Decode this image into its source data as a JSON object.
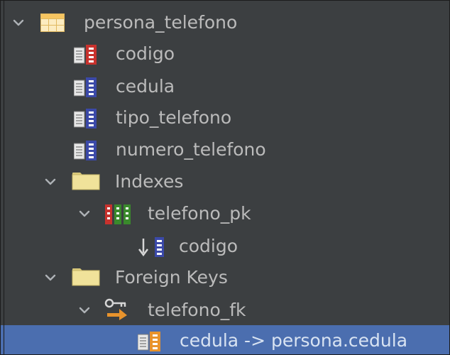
{
  "tree": {
    "table": {
      "label": "persona_telefono",
      "expanded": true,
      "icon": "table-icon",
      "columns": [
        {
          "label": "codigo",
          "icon": "primary-key-column-icon"
        },
        {
          "label": "cedula",
          "icon": "column-icon"
        },
        {
          "label": "tipo_telefono",
          "icon": "column-icon"
        },
        {
          "label": "numero_telefono",
          "icon": "column-icon"
        }
      ],
      "indexes": {
        "label": "Indexes",
        "expanded": true,
        "icon": "folder-icon",
        "items": [
          {
            "label": "telefono_pk",
            "expanded": true,
            "icon": "unique-index-icon",
            "columns": [
              {
                "label": "codigo",
                "icon": "index-column-icon"
              }
            ]
          }
        ]
      },
      "foreign_keys": {
        "label": "Foreign Keys",
        "expanded": true,
        "icon": "folder-icon",
        "items": [
          {
            "label": "telefono_fk",
            "expanded": true,
            "icon": "foreign-key-icon",
            "references": [
              {
                "label": "cedula -> persona.cedula",
                "icon": "fk-column-icon",
                "selected": true
              }
            ]
          }
        ]
      }
    }
  },
  "colors": {
    "panel_background": "#3c3f41",
    "selection_background": "#4b6eaf",
    "text": "#bbbbbb",
    "selected_text": "#d8e3f2",
    "primary_key_red": "#c8322d",
    "column_blue": "#3b49a8",
    "folder_yellow": "#f0e29a",
    "key_orange": "#e8932c"
  }
}
